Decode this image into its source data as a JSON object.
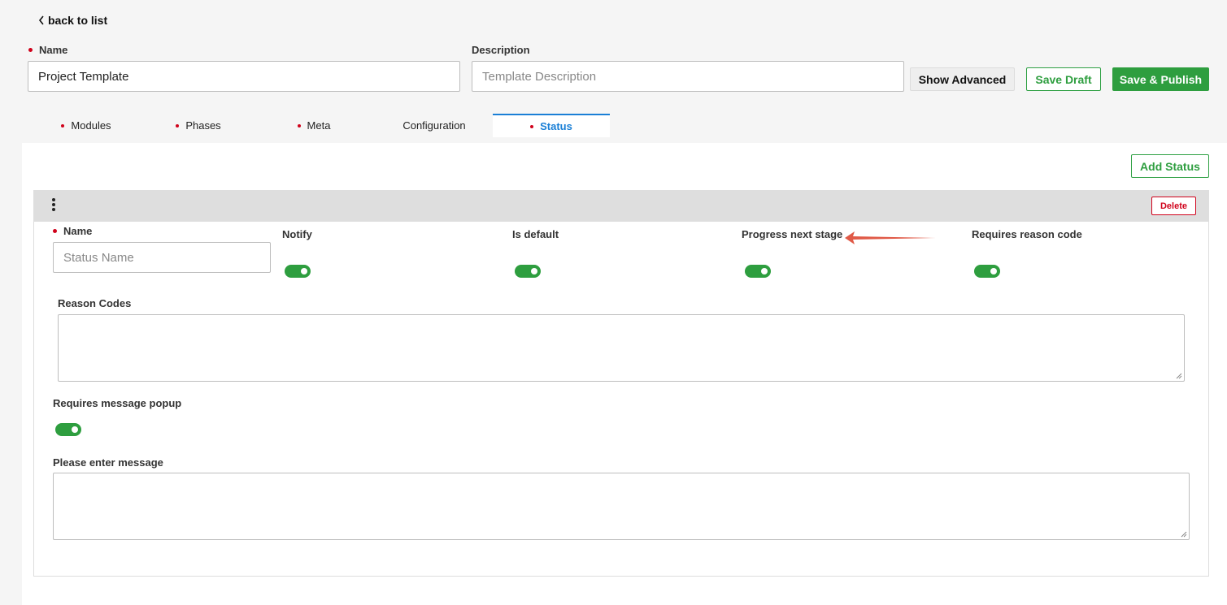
{
  "nav": {
    "back_label": "back to list"
  },
  "template": {
    "name_label": "Name",
    "name_value": "Project Template",
    "description_label": "Description",
    "description_placeholder": "Template Description"
  },
  "actions": {
    "show_advanced": "Show Advanced",
    "save_draft": "Save Draft",
    "save_publish": "Save & Publish"
  },
  "tabs": [
    {
      "label": "Modules",
      "required": true,
      "active": false
    },
    {
      "label": "Phases",
      "required": true,
      "active": false
    },
    {
      "label": "Meta",
      "required": true,
      "active": false
    },
    {
      "label": "Configuration",
      "required": false,
      "active": false
    },
    {
      "label": "Status",
      "required": true,
      "active": true
    }
  ],
  "status_panel": {
    "add_status": "Add Status",
    "card": {
      "delete_label": "Delete",
      "name_label": "Name",
      "name_placeholder": "Status Name",
      "toggles": [
        {
          "label": "Notify",
          "on": true
        },
        {
          "label": "Is default",
          "on": true
        },
        {
          "label": "Progress next stage",
          "on": true
        },
        {
          "label": "Requires reason code",
          "on": true
        }
      ],
      "reason_codes_label": "Reason Codes",
      "requires_message_popup_label": "Requires message popup",
      "requires_message_popup_on": true,
      "message_label": "Please enter message"
    }
  },
  "colors": {
    "accent_green": "#2e9e3f",
    "required_red": "#d0021b",
    "active_tab_blue": "#1a7fd6",
    "annotation_arrow": "#e05a47"
  },
  "icons": {
    "back": "chevron-left-icon",
    "card_menu": "kebab-menu-icon",
    "annotation": "red-arrow-annotation"
  }
}
